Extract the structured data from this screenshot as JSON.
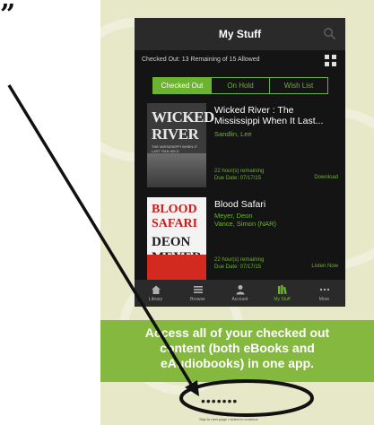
{
  "quote": "”",
  "nav": {
    "title": "My Stuff",
    "search_icon": "search-icon"
  },
  "status": {
    "text": "Checked Out: 13 Remaining of 15 Allowed",
    "view_icon": "grid-view-icon"
  },
  "tabs": [
    {
      "label": "Checked Out",
      "active": true
    },
    {
      "label": "On Hold",
      "active": false
    },
    {
      "label": "Wish List",
      "active": false
    }
  ],
  "books": [
    {
      "cover": {
        "line1": "WICKED",
        "line2": "RIVER",
        "line3": "THE MISSISSIPPI WHEN IT LAST RAN WILD"
      },
      "title": "Wicked River : The Mississippi When It Last...",
      "authors": "Sandlin, Lee",
      "remaining": "22 hour(s) remaining",
      "due": "Due Date: 07/17/15",
      "action": "Download"
    },
    {
      "cover": {
        "line1": "BLOOD",
        "line2": "SAFARI",
        "line3": "DEON MEYER"
      },
      "title": "Blood Safari",
      "authors": "Meyer, Deon\nVance, Simon (NAR)",
      "remaining": "22 hour(s) remaining",
      "due": "Due Date: 07/17/15",
      "action": "Listen Now"
    }
  ],
  "tab_bar": [
    {
      "label": "Library",
      "icon": "home-icon",
      "active": false
    },
    {
      "label": "Browse",
      "icon": "list-icon",
      "active": false
    },
    {
      "label": "Account",
      "icon": "person-icon",
      "active": false
    },
    {
      "label": "My Stuff",
      "icon": "books-icon",
      "active": true
    },
    {
      "label": "More",
      "icon": "more-icon",
      "active": false
    }
  ],
  "banner": {
    "line1": "Access all of your checked out",
    "line2": "content (both eBooks and",
    "line3": "eAudiobooks) in one app."
  },
  "page_dots": "•••••••",
  "footer_note": "Skip to next page • select to continue",
  "colors": {
    "accent": "#6cb32f",
    "banner": "#85b83f",
    "phone_bg": "#141414",
    "bar_bg": "#2a2a2a"
  }
}
